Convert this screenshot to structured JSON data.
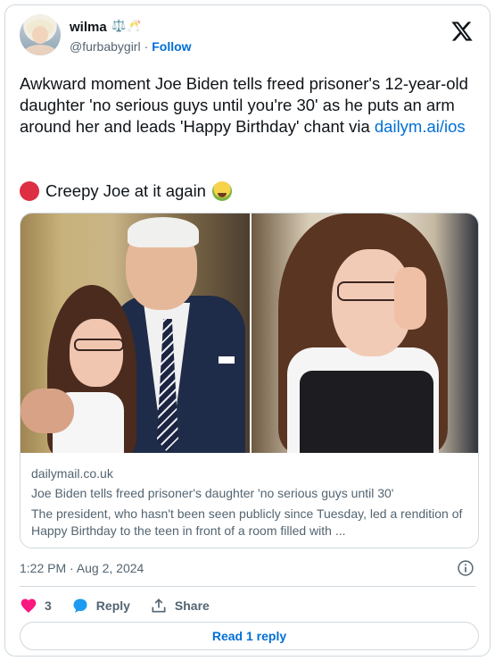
{
  "author": {
    "display_name": "wilma",
    "name_emojis": "⚖️🥂",
    "handle": "@furbabygirl",
    "separator": "·",
    "follow_label": "Follow"
  },
  "tweet": {
    "text": "Awkward moment Joe Biden tells freed prisoner's 12-year-old daughter 'no serious guys until you're 30' as he puts an arm around her and leads 'Happy Birthday' chant via",
    "link_text": "dailym.ai/ios",
    "second_line": "Creepy Joe at it again"
  },
  "link_card": {
    "domain": "dailymail.co.uk",
    "title": "Joe Biden tells freed prisoner's daughter 'no serious guys until 30'",
    "description": "The president, who hasn't been seen publicly since Tuesday, led a rendition of Happy Birthday to the teen in front of a room filled with ..."
  },
  "timestamp": "1:22 PM · Aug 2, 2024",
  "actions": {
    "like_count": "3",
    "reply_label": "Reply",
    "share_label": "Share",
    "read_replies_label": "Read 1 reply"
  },
  "colors": {
    "link_blue": "#006fd6",
    "like_pink": "#f91880",
    "reply_blue": "#1d9bf0",
    "red_circle": "#dd2e44"
  }
}
